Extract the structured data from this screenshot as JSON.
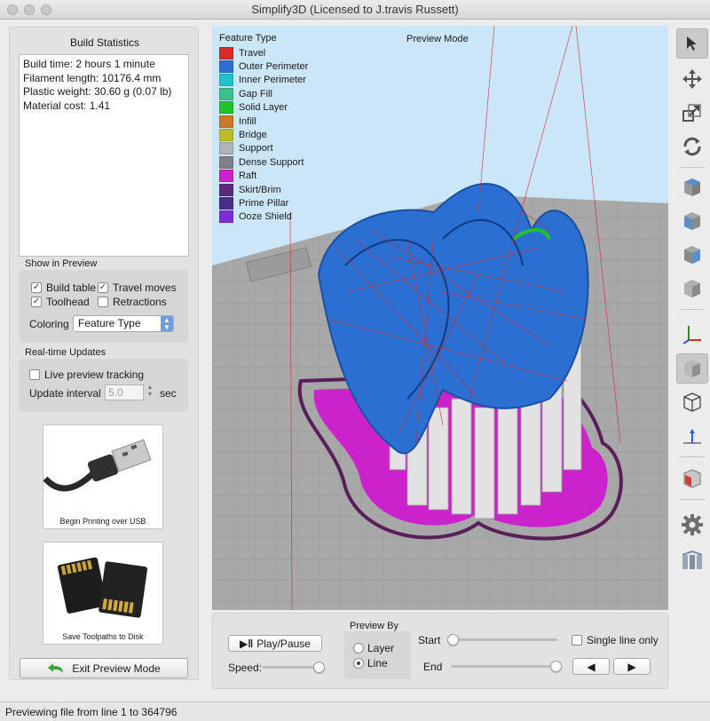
{
  "window": {
    "title": "Simplify3D (Licensed to J.travis Russett)"
  },
  "left_panel": {
    "build_stats_title": "Build Statistics",
    "stats_lines": [
      "Build time: 2 hours 1 minute",
      "Filament length: 10176.4 mm",
      "Plastic weight: 30.60 g (0.07 lb)",
      "Material cost: 1.41"
    ],
    "show_in_preview_label": "Show in Preview",
    "checkboxes": {
      "build_table": {
        "label": "Build table",
        "checked": true
      },
      "travel_moves": {
        "label": "Travel moves",
        "checked": true
      },
      "toolhead": {
        "label": "Toolhead",
        "checked": true
      },
      "retractions": {
        "label": "Retractions",
        "checked": false
      }
    },
    "coloring_label": "Coloring",
    "coloring_value": "Feature Type",
    "realtime_label": "Real-time Updates",
    "live_preview": {
      "label": "Live preview tracking",
      "checked": false
    },
    "update_interval_label": "Update interval",
    "update_interval_value": "5.0",
    "update_interval_unit": "sec",
    "usb_caption": "Begin Printing over USB",
    "sd_caption": "Save Toolpaths to Disk",
    "exit_label": "Exit Preview Mode"
  },
  "viewport": {
    "legend_title": "Feature Type",
    "preview_mode_label": "Preview Mode",
    "legend": [
      {
        "label": "Travel",
        "color": "#d42b2b"
      },
      {
        "label": "Outer Perimeter",
        "color": "#2a6fd1"
      },
      {
        "label": "Inner Perimeter",
        "color": "#1ec3cf"
      },
      {
        "label": "Gap Fill",
        "color": "#3cc08a"
      },
      {
        "label": "Solid Layer",
        "color": "#22c22a"
      },
      {
        "label": "Infill",
        "color": "#c8792a"
      },
      {
        "label": "Bridge",
        "color": "#bdbb2a"
      },
      {
        "label": "Support",
        "color": "#aeb3b5"
      },
      {
        "label": "Dense Support",
        "color": "#7e8284"
      },
      {
        "label": "Raft",
        "color": "#cc22cc"
      },
      {
        "label": "Skirt/Brim",
        "color": "#5c2a7a"
      },
      {
        "label": "Prime Pillar",
        "color": "#4a2a8a"
      },
      {
        "label": "Ooze Shield",
        "color": "#7e2ed6"
      }
    ]
  },
  "controls": {
    "play_pause_label": "Play/Pause",
    "speed_label": "Speed:",
    "speed_level": 0.9,
    "preview_by_label": "Preview By",
    "preview_by_options": [
      "Layer",
      "Line"
    ],
    "preview_by_selected": "Line",
    "start_label": "Start",
    "start_level": 0.0,
    "end_label": "End",
    "end_level": 1.0,
    "single_line_label": "Single line only",
    "single_line_checked": false
  },
  "toolbar": {
    "tools": [
      "select-tool-icon",
      "move-tool-icon",
      "scale-tool-icon",
      "rotate-tool-icon",
      "view-cube-top-icon",
      "view-cube-front-icon",
      "view-cube-left-icon",
      "view-cube-right-icon",
      "axes-icon",
      "solid-view-icon",
      "wireframe-view-icon",
      "normals-view-icon",
      "cross-section-icon",
      "settings-gear-icon",
      "machine-control-icon"
    ]
  },
  "statusbar": {
    "text": "Previewing file from line 1 to 364796"
  }
}
